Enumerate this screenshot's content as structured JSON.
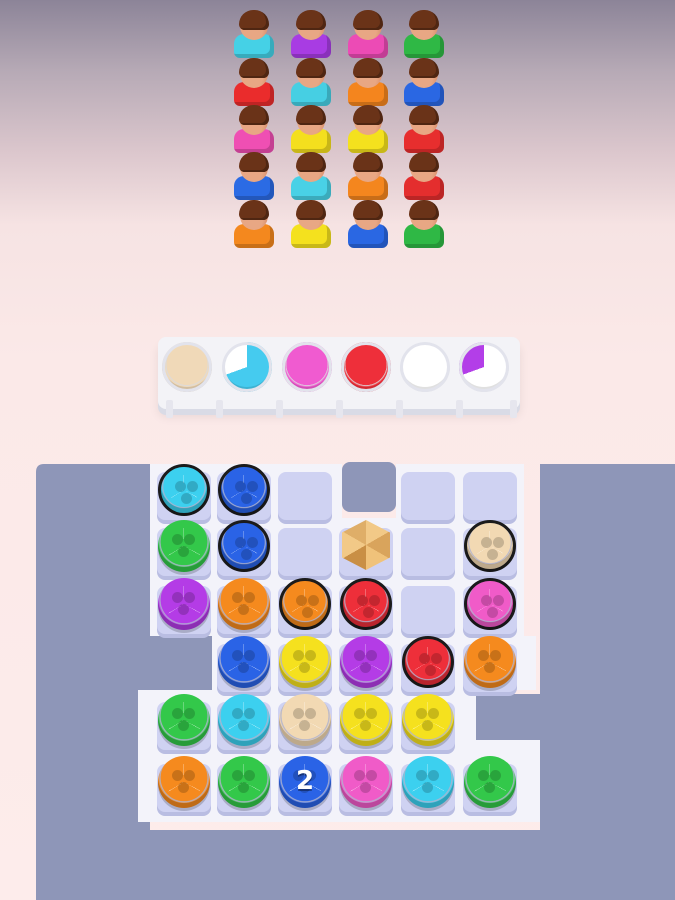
{
  "game": {
    "customer_rows": [
      [
        "#45d1e6",
        "#a83ce3",
        "#ec4bb5",
        "#2fb845"
      ],
      [
        "#ea2c2c",
        "#46cfe3",
        "#f4851e",
        "#2a67e3"
      ],
      [
        "#ef4fb3",
        "#f4df1e",
        "#f4e11e",
        "#e72e2e"
      ],
      [
        "#2b6be4",
        "#49d1e6",
        "#f4861e",
        "#e42e2e"
      ],
      [
        "#f4881e",
        "#f4e11e",
        "#2a67e3",
        "#2fb845"
      ]
    ],
    "shelf_slots": [
      {
        "color": "#f0d9b8",
        "fill": "full"
      },
      {
        "color": "#45cbef",
        "fill": "partial"
      },
      {
        "color": "#f05bd0",
        "fill": "full"
      },
      {
        "color": "#ee2f3a",
        "fill": "full"
      },
      {
        "color": "#ffffff",
        "fill": "empty"
      },
      {
        "color": "#b33ee8",
        "fill": "sliver"
      }
    ],
    "grid": [
      [
        {
          "c": "#3cd0ef",
          "o": true
        },
        {
          "c": "#2a63e6",
          "o": true
        },
        {
          "c": null
        },
        {
          "c": "hole"
        },
        {
          "c": null
        },
        {
          "c": null
        }
      ],
      [
        {
          "c": "#33c84a"
        },
        {
          "c": "#2a63e6",
          "o": true
        },
        {
          "c": null
        },
        {
          "c": "box"
        },
        {
          "c": null
        },
        {
          "c": "#f2d9b3",
          "o": true
        }
      ],
      [
        {
          "c": "#b43ce6"
        },
        {
          "c": "#f58a1e"
        },
        {
          "c": "#f58a1e",
          "o": true
        },
        {
          "c": "#ee2f3a",
          "o": true
        },
        {
          "c": null
        },
        {
          "c": "#f05bc8",
          "o": true
        }
      ],
      [
        {
          "c": "none"
        },
        {
          "c": "#2a63e6"
        },
        {
          "c": "#f5e11e"
        },
        {
          "c": "#b43ce6"
        },
        {
          "c": "#ee2f3a",
          "o": true
        },
        {
          "c": "#f58a1e"
        }
      ],
      [
        {
          "c": "#33c84a"
        },
        {
          "c": "#3cd0ef"
        },
        {
          "c": "#f2d9b3"
        },
        {
          "c": "#f5e11e"
        },
        {
          "c": "#f5e11e"
        },
        {
          "c": "none"
        }
      ],
      [
        {
          "c": "#f58a1e"
        },
        {
          "c": "#33c84a"
        },
        {
          "c": "#2a63e6",
          "badge": true
        },
        {
          "c": "#f05bc8"
        },
        {
          "c": "#3cd0ef"
        },
        {
          "c": "#33c84a"
        }
      ]
    ],
    "stack_badge": "2",
    "colors": {
      "board_bg": "#8e96b8",
      "board_frame": "#f3f3fa",
      "tile": "#cfd2f2"
    }
  }
}
